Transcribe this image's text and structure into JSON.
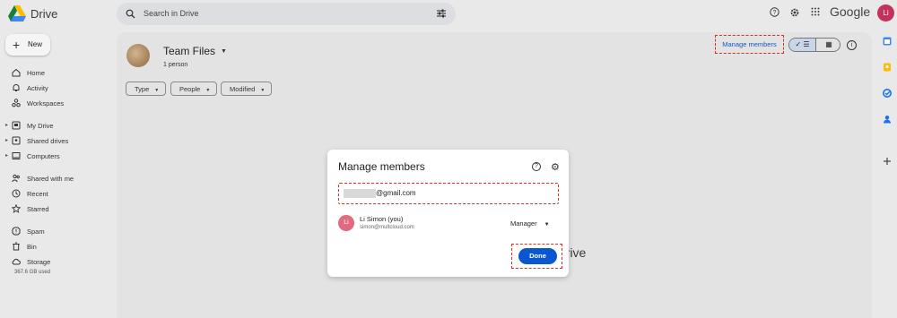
{
  "app": {
    "name": "Drive"
  },
  "search": {
    "placeholder": "Search in Drive"
  },
  "header": {
    "brand": "Google",
    "avatar_initials": "Li"
  },
  "sidebar": {
    "new_label": "New",
    "items": [
      {
        "label": "Home",
        "icon": "home-icon"
      },
      {
        "label": "Activity",
        "icon": "bell-icon"
      },
      {
        "label": "Workspaces",
        "icon": "workspaces-icon"
      },
      {
        "label": "My Drive",
        "icon": "my-drive-icon"
      },
      {
        "label": "Shared drives",
        "icon": "shared-drives-icon"
      },
      {
        "label": "Computers",
        "icon": "computer-icon"
      },
      {
        "label": "Shared with me",
        "icon": "people-icon"
      },
      {
        "label": "Recent",
        "icon": "clock-icon"
      },
      {
        "label": "Starred",
        "icon": "star-icon"
      },
      {
        "label": "Spam",
        "icon": "spam-icon"
      },
      {
        "label": "Bin",
        "icon": "bin-icon"
      },
      {
        "label": "Storage",
        "icon": "cloud-icon"
      }
    ],
    "storage_used": "367.6 GB used"
  },
  "drive": {
    "title": "Team Files",
    "subtitle": "1 person",
    "filters": [
      "Type",
      "People",
      "Modified"
    ],
    "manage_members_label": "Manage members",
    "background_text": "drive"
  },
  "modal": {
    "title": "Manage members",
    "email_value": "@gmail.com",
    "member": {
      "initials": "Li",
      "name": "Li Simon (you)",
      "email": "simon@multcloud.com",
      "role": "Manager"
    },
    "done_label": "Done"
  },
  "colors": {
    "accent": "#0b57d0",
    "highlight_dash": "#d93025",
    "avatar_top": "#c4325c",
    "avatar_member": "#e06a7e"
  }
}
